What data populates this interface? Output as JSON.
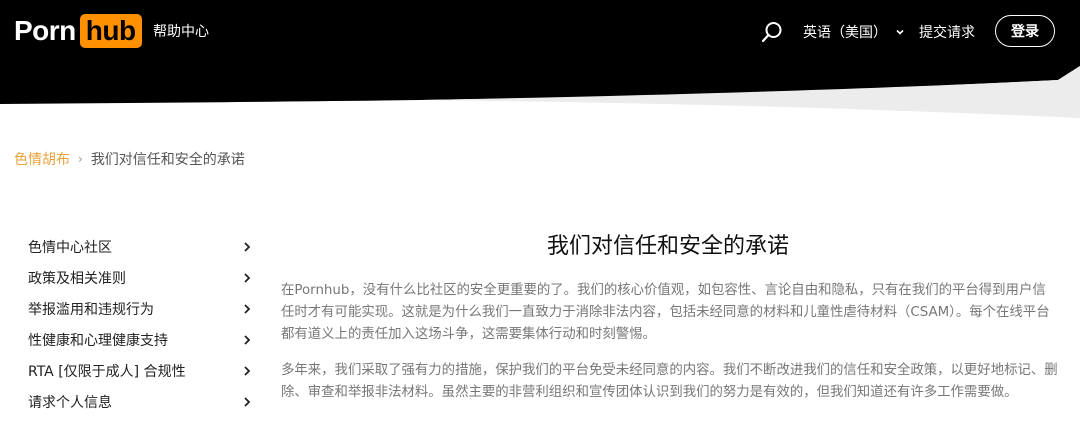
{
  "header": {
    "logo_part1": "Porn",
    "logo_part2": "hub",
    "help_center": "帮助中心",
    "language": "英语（美国）",
    "submit_request": "提交请求",
    "login": "登录"
  },
  "breadcrumb": {
    "home": "色情胡布",
    "separator": "›",
    "current": "我们对信任和安全的承诺"
  },
  "sidebar": {
    "items": [
      {
        "label": "色情中心社区"
      },
      {
        "label": "政策及相关准则"
      },
      {
        "label": "举报滥用和违规行为"
      },
      {
        "label": "性健康和心理健康支持"
      },
      {
        "label": "RTA [仅限于成人] 合规性"
      },
      {
        "label": "请求个人信息"
      }
    ]
  },
  "article": {
    "title": "我们对信任和安全的承诺",
    "paragraphs": [
      "在Pornhub，没有什么比社区的安全更重要的了。我们的核心价值观，如包容性、言论自由和隐私，只有在我们的平台得到用户信任时才有可能实现。这就是为什么我们一直致力于消除非法内容，包括未经同意的材料和儿童性虐待材料（CSAM）。每个在线平台都有道义上的责任加入这场斗争，这需要集体行动和时刻警惕。",
      "多年来，我们采取了强有力的措施，保护我们的平台免受未经同意的内容。我们不断改进我们的信任和安全政策，以更好地标记、删除、审查和举报非法材料。虽然主要的非营利组织和宣传团体认识到我们的努力是有效的，但我们知道还有许多工作需要做。"
    ]
  },
  "colors": {
    "header_bg": "#000000",
    "brand_orange": "#ff9000",
    "breadcrumb_link": "#e8a23a",
    "body_text": "#777777"
  },
  "icons": {
    "search": "search-icon",
    "language_dropdown": "chevron-down-icon",
    "sidebar_chevron": "chevron-right-icon"
  }
}
